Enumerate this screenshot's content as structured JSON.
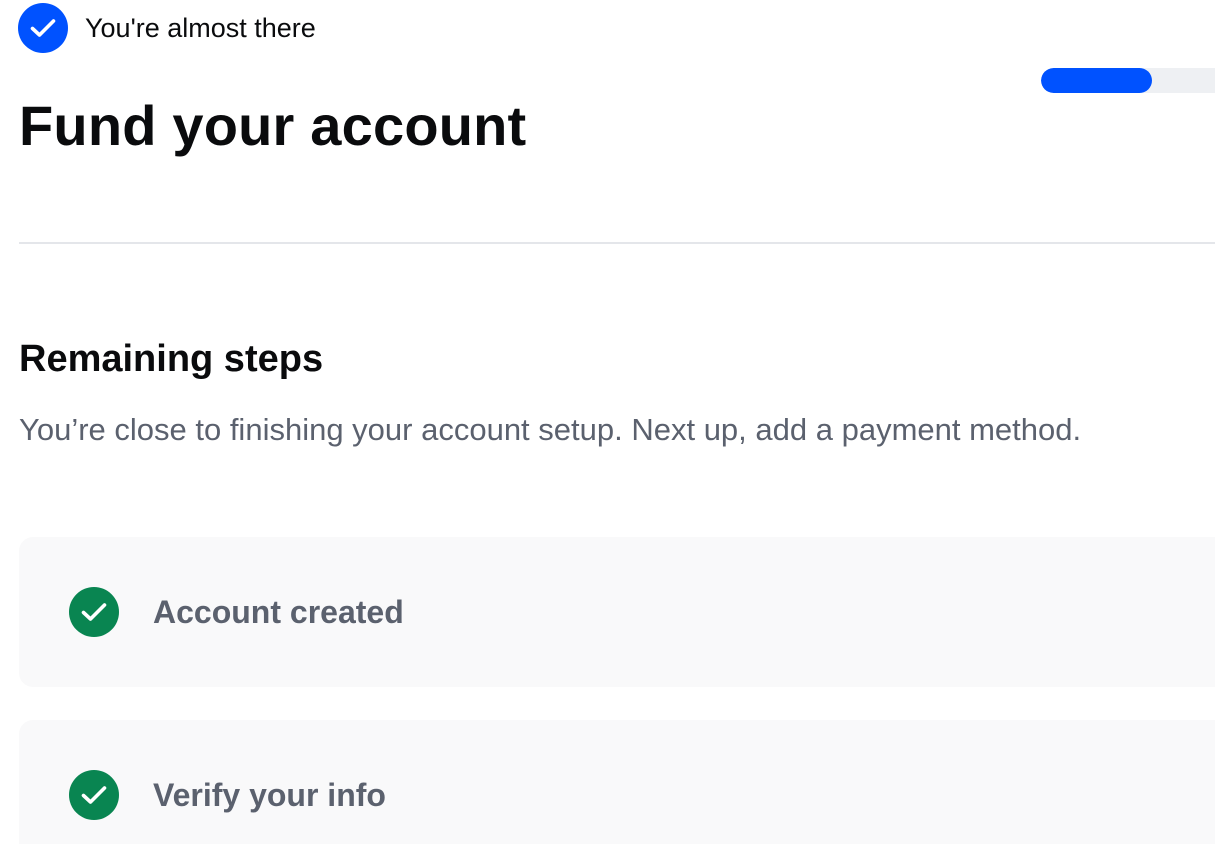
{
  "header": {
    "status_text": "You're almost there",
    "status_icon": "check-circle-icon",
    "progress_fraction": 0.21
  },
  "page": {
    "title": "Fund your account"
  },
  "remaining": {
    "title": "Remaining steps",
    "description": "You’re close to finishing your account setup. Next up, add a payment method."
  },
  "steps": [
    {
      "label": "Account created",
      "icon": "check-circle-icon",
      "status": "complete"
    },
    {
      "label": "Verify your info",
      "icon": "check-circle-icon",
      "status": "complete"
    }
  ],
  "colors": {
    "accent_blue": "#0052ff",
    "success_green": "#098551",
    "track_gray": "#eef0f3",
    "card_bg": "#f9f9fa",
    "muted_text": "#5b616e"
  }
}
